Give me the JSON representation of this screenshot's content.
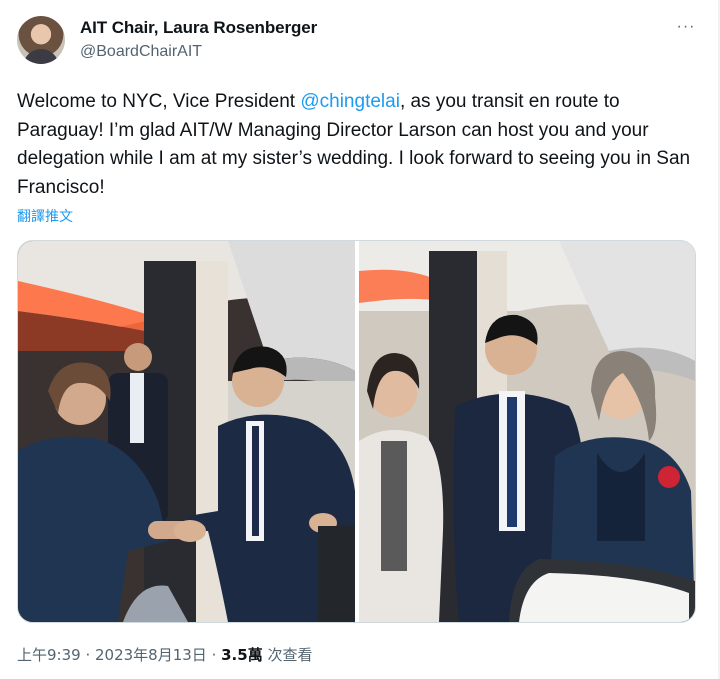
{
  "author": {
    "display_name": "AIT Chair, Laura Rosenberger",
    "handle": "@BoardChairAIT"
  },
  "more_label": "···",
  "tweet": {
    "text_before_mention": "Welcome to NYC, Vice President ",
    "mention": "@chingtelai",
    "text_after_mention": ", as you transit en route to Paraguay! I’m glad AIT/W Managing Director Larson can host you and your delegation while I am at my sister’s wedding. I look forward to seeing you in San Francisco!"
  },
  "translate_label": "翻譯推文",
  "footer": {
    "time": "上午9:39",
    "sep1": " · ",
    "date": "2023年8月13日",
    "sep2": " · ",
    "views_count": "3.5萬",
    "views_label": " 次查看"
  },
  "colors": {
    "link": "#1d9bf0",
    "secondary_text": "#536471",
    "primary_text": "#0f1419",
    "border": "#cfd9de"
  },
  "icons": [
    "more-icon"
  ]
}
